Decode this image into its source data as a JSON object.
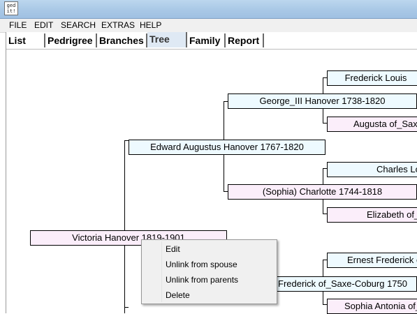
{
  "window": {
    "icon_text": "ged it!"
  },
  "menu": [
    "FILE",
    "EDIT",
    "SEARCH",
    "EXTRAS",
    "HELP"
  ],
  "tabs": [
    "List",
    "Pedrigree",
    "Branches",
    "Tree",
    "Family",
    "Report"
  ],
  "active_tab": "Tree",
  "tree": {
    "victoria": "Victoria  Hanover 1819-1901",
    "edward": "Edward Augustus  Hanover 1767-1820",
    "george": "George_III  Hanover 1738-1820",
    "frederick_louis": "Frederick Louis",
    "augusta": "Augusta of_Saxe",
    "charlotte": "(Sophia) Charlotte   1744-1818",
    "charles": "Charles Lo",
    "elizabeth": "Elizabeth of_",
    "ernest": "Ernest Frederick o",
    "frederick_saxe": "Frederick of_Saxe-Coburg  1750",
    "sophia_antonia": "Sophia Antonia of_"
  },
  "context_menu": [
    "Edit",
    "Unlink from spouse",
    "Unlink from parents",
    "Delete"
  ]
}
